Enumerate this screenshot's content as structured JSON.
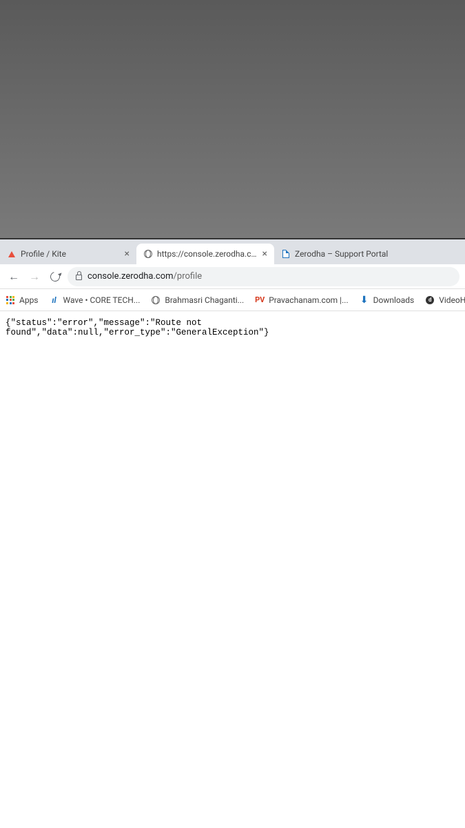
{
  "tabs": [
    {
      "title": "Profile / Kite",
      "active": false
    },
    {
      "title": "https://console.zerodha.com/pro",
      "active": true
    },
    {
      "title": "Zerodha – Support Portal",
      "active": false
    }
  ],
  "address": {
    "host": "console.zerodha.com",
    "path": "/profile"
  },
  "bookmarks": {
    "apps": "Apps",
    "wave": "Wave • CORE TECH...",
    "brahmasri": "Brahmasri Chaganti...",
    "pravachanam": "Pravachanam.com |...",
    "downloads": "Downloads",
    "videoh": "VideoH"
  },
  "page": {
    "json_response": "{\"status\":\"error\",\"message\":\"Route not found\",\"data\":null,\"error_type\":\"GeneralException\"}"
  }
}
